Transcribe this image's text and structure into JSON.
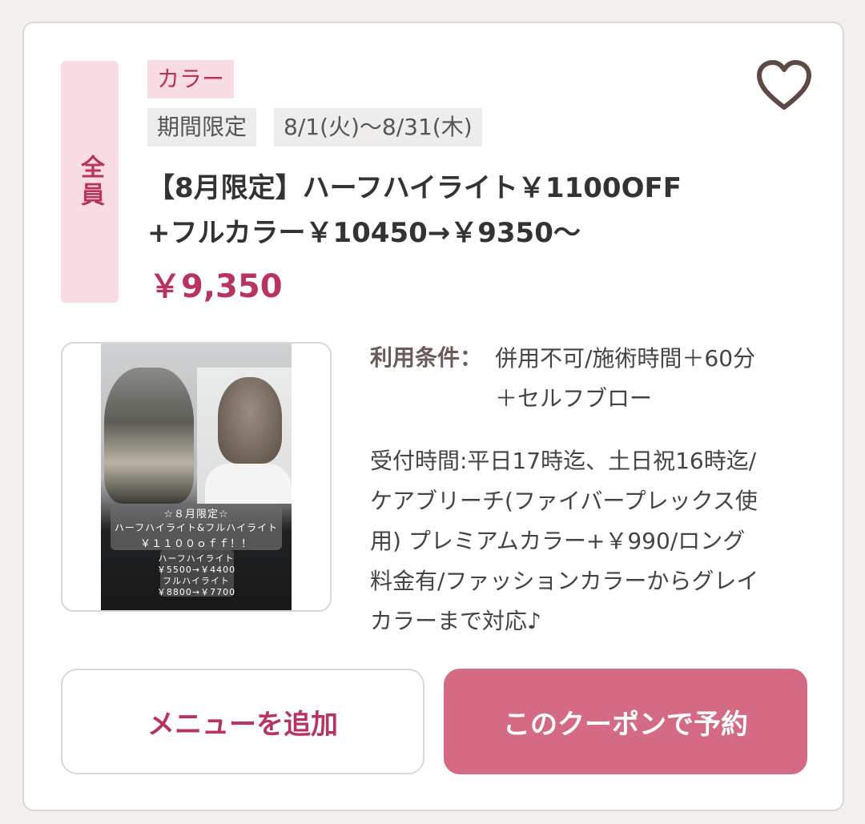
{
  "coupon": {
    "target": "全員",
    "category": "カラー",
    "tags": {
      "limited": "期間限定",
      "period": "8/1(火)〜8/31(木)"
    },
    "title_line1": "【8月限定】ハーフハイライト￥1100OFF",
    "title_line2": "+フルカラー￥10450→￥9350〜",
    "price": "￥9,350",
    "favorite_icon": "heart-outline-icon",
    "image": {
      "line1": "☆８月限定☆",
      "line2": "ハーフハイライト&フルハイライト",
      "line3": "￥１１００ｏｆｆ！！",
      "line4": "ハーフハイライト",
      "line5": "￥5500→￥4400",
      "line6": "フルハイライト",
      "line7": "￥8800→￥7700"
    },
    "conditions_label": "利用条件：",
    "conditions_line1": "併用不可/施術時間＋60分",
    "conditions_line2": "＋セルフブロー",
    "description_lines": [
      "受付時間:平日17時迄、土日祝16時迄/",
      "ケアブリーチ(ファイバープレックス使",
      "用) プレミアムカラー+￥990/ロング",
      "料金有/ファッションカラーからグレイ",
      "カラーまで対応♪"
    ],
    "buttons": {
      "add_menu": "メニューを追加",
      "reserve": "このクーポンで予約"
    },
    "colors": {
      "accent": "#b8345f",
      "tag_bg": "#f9dde3",
      "reserve_bg": "#d46a84",
      "border": "#dcd7d4"
    }
  }
}
